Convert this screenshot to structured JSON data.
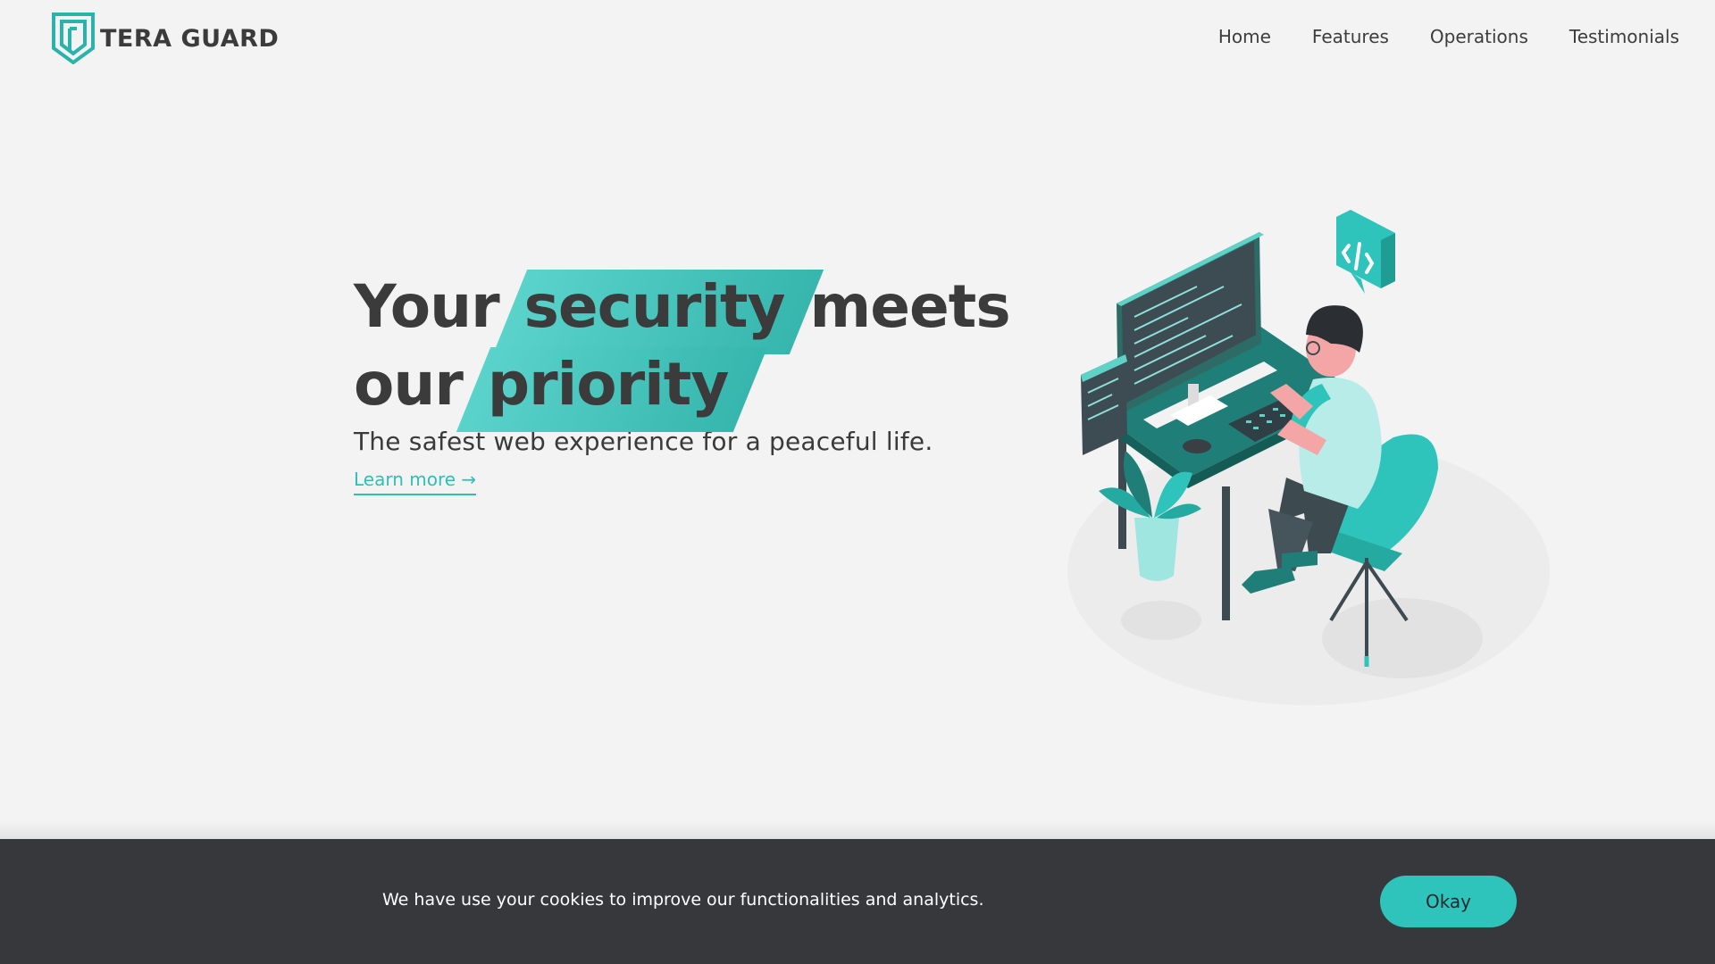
{
  "brand": {
    "name": "TERA GUARD",
    "accent": "#2ec4bb"
  },
  "nav": {
    "items": [
      {
        "label": "Home"
      },
      {
        "label": "Features"
      },
      {
        "label": "Operations"
      },
      {
        "label": "Testimonials"
      }
    ]
  },
  "hero": {
    "headline_part1": "Your",
    "headline_highlight1": "security",
    "headline_part2": "meets",
    "headline_part3": "our",
    "headline_highlight2": "priority",
    "subtitle": "The safest web experience for a peaceful life.",
    "cta": "Learn more →"
  },
  "illustration": {
    "icon": "developer-at-desk-illustration",
    "badge_icon": "code-icon"
  },
  "cookie": {
    "message": "We have use your cookies to improve our functionalities and analytics.",
    "button": "Okay"
  }
}
